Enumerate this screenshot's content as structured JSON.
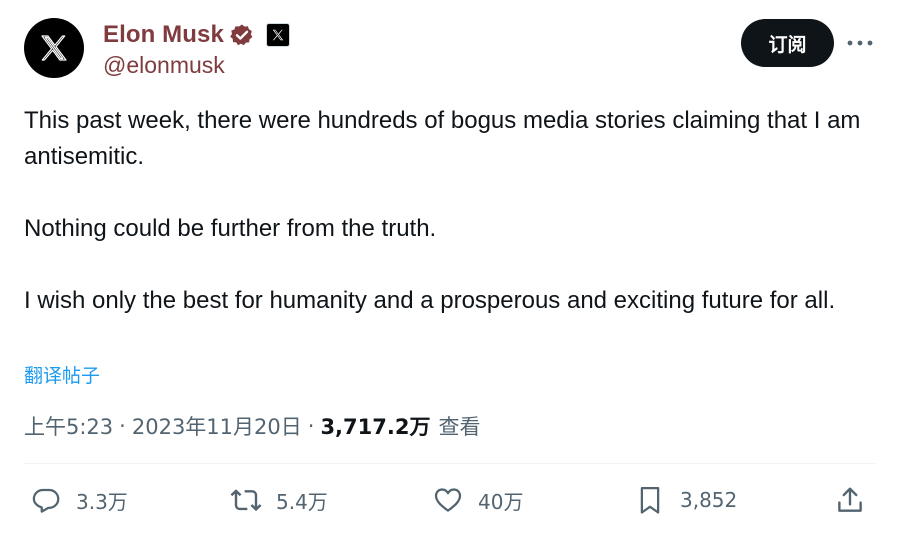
{
  "author": {
    "display_name": "Elon Musk",
    "handle": "@elonmusk",
    "avatar_icon": "x-logo-icon",
    "verified_icon": "verified-badge-icon",
    "affiliate_icon": "x-affiliate-icon"
  },
  "header": {
    "subscribe_label": "订阅",
    "more_icon": "more-icon"
  },
  "tweet": {
    "paragraphs": [
      "This past week, there were hundreds of bogus media stories claiming that I am antisemitic.",
      "Nothing could be further from the truth.",
      "I wish only the best for humanity and a prosperous and exciting future for all."
    ],
    "translate_label": "翻译帖子"
  },
  "meta": {
    "time": "上午5:23",
    "separator": "·",
    "date": "2023年11月20日",
    "views_count": "3,717.2万",
    "views_label": "查看"
  },
  "actions": {
    "replies": "3.3万",
    "reposts": "5.4万",
    "likes": "40万",
    "bookmarks": "3,852"
  },
  "colors": {
    "name": "#7f3b3e",
    "link": "#1d9bf0",
    "muted": "#536471",
    "text": "#0f1419",
    "verified": "#7f3b3e"
  }
}
